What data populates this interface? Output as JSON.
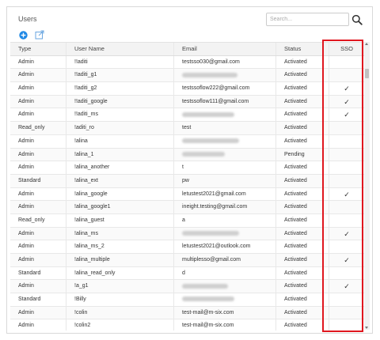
{
  "panel": {
    "title": "Users",
    "search_placeholder": "Search...",
    "search_value": ""
  },
  "icons": {
    "search": "search-icon",
    "add": "add-circle-icon",
    "export": "export-icon"
  },
  "colors": {
    "accent": "#1e88e5",
    "highlight": "#e0171f"
  },
  "table": {
    "columns": [
      "Type",
      "User Name",
      "Email",
      "Status",
      "SSO"
    ],
    "rows": [
      {
        "type": "Admin",
        "user": "!!aditi",
        "email": "testsso030@gmail.com",
        "email_hidden": false,
        "status": "Activated",
        "sso": ""
      },
      {
        "type": "Admin",
        "user": "!!aditi_g1",
        "email": "",
        "email_hidden": true,
        "status": "Activated",
        "sso": ""
      },
      {
        "type": "Admin",
        "user": "!!aditi_g2",
        "email": "testssoflow222@gmail.com",
        "email_hidden": false,
        "status": "Activated",
        "sso": "✓"
      },
      {
        "type": "Admin",
        "user": "!!aditi_google",
        "email": "testssoflow111@gmail.com",
        "email_hidden": false,
        "status": "Activated",
        "sso": "✓"
      },
      {
        "type": "Admin",
        "user": "!!aditi_ms",
        "email": "",
        "email_hidden": true,
        "status": "Activated",
        "sso": "✓"
      },
      {
        "type": "Read_only",
        "user": "!aditi_ro",
        "email": "test",
        "email_hidden": false,
        "status": "Activated",
        "sso": ""
      },
      {
        "type": "Admin",
        "user": "!alina",
        "email": "",
        "email_hidden": true,
        "status": "Activated",
        "sso": ""
      },
      {
        "type": "Admin",
        "user": "!alina_1",
        "email": "",
        "email_hidden": true,
        "status": "Pending",
        "sso": ""
      },
      {
        "type": "Admin",
        "user": "!alina_another",
        "email": "t",
        "email_hidden": false,
        "status": "Activated",
        "sso": ""
      },
      {
        "type": "Standard",
        "user": "!alina_ext",
        "email": "pw",
        "email_hidden": false,
        "status": "Activated",
        "sso": ""
      },
      {
        "type": "Admin",
        "user": "!alina_google",
        "email": "letustest2021@gmail.com",
        "email_hidden": false,
        "status": "Activated",
        "sso": "✓"
      },
      {
        "type": "Admin",
        "user": "!alina_google1",
        "email": "ineight.testing@gmail.com",
        "email_hidden": false,
        "status": "Activated",
        "sso": ""
      },
      {
        "type": "Read_only",
        "user": "!alina_guest",
        "email": "a",
        "email_hidden": false,
        "status": "Activated",
        "sso": ""
      },
      {
        "type": "Admin",
        "user": "!alina_ms",
        "email": "",
        "email_hidden": true,
        "status": "Activated",
        "sso": "✓"
      },
      {
        "type": "Admin",
        "user": "!alina_ms_2",
        "email": "letustest2021@outlook.com",
        "email_hidden": false,
        "status": "Activated",
        "sso": ""
      },
      {
        "type": "Admin",
        "user": "!alina_multiple",
        "email": "multiplesso@gmail.com",
        "email_hidden": false,
        "status": "Activated",
        "sso": "✓"
      },
      {
        "type": "Standard",
        "user": "!alina_read_only",
        "email": "d",
        "email_hidden": false,
        "status": "Activated",
        "sso": ""
      },
      {
        "type": "Admin",
        "user": "!a_g1",
        "email": "",
        "email_hidden": true,
        "status": "Activated",
        "sso": "✓"
      },
      {
        "type": "Standard",
        "user": "!Billy",
        "email": "",
        "email_hidden": true,
        "status": "Activated",
        "sso": ""
      },
      {
        "type": "Admin",
        "user": "!colin",
        "email": "test-mail@m-six.com",
        "email_hidden": false,
        "status": "Activated",
        "sso": ""
      },
      {
        "type": "Admin",
        "user": "!colin2",
        "email": "test-mail@m-six.com",
        "email_hidden": false,
        "status": "Activated",
        "sso": ""
      }
    ]
  }
}
